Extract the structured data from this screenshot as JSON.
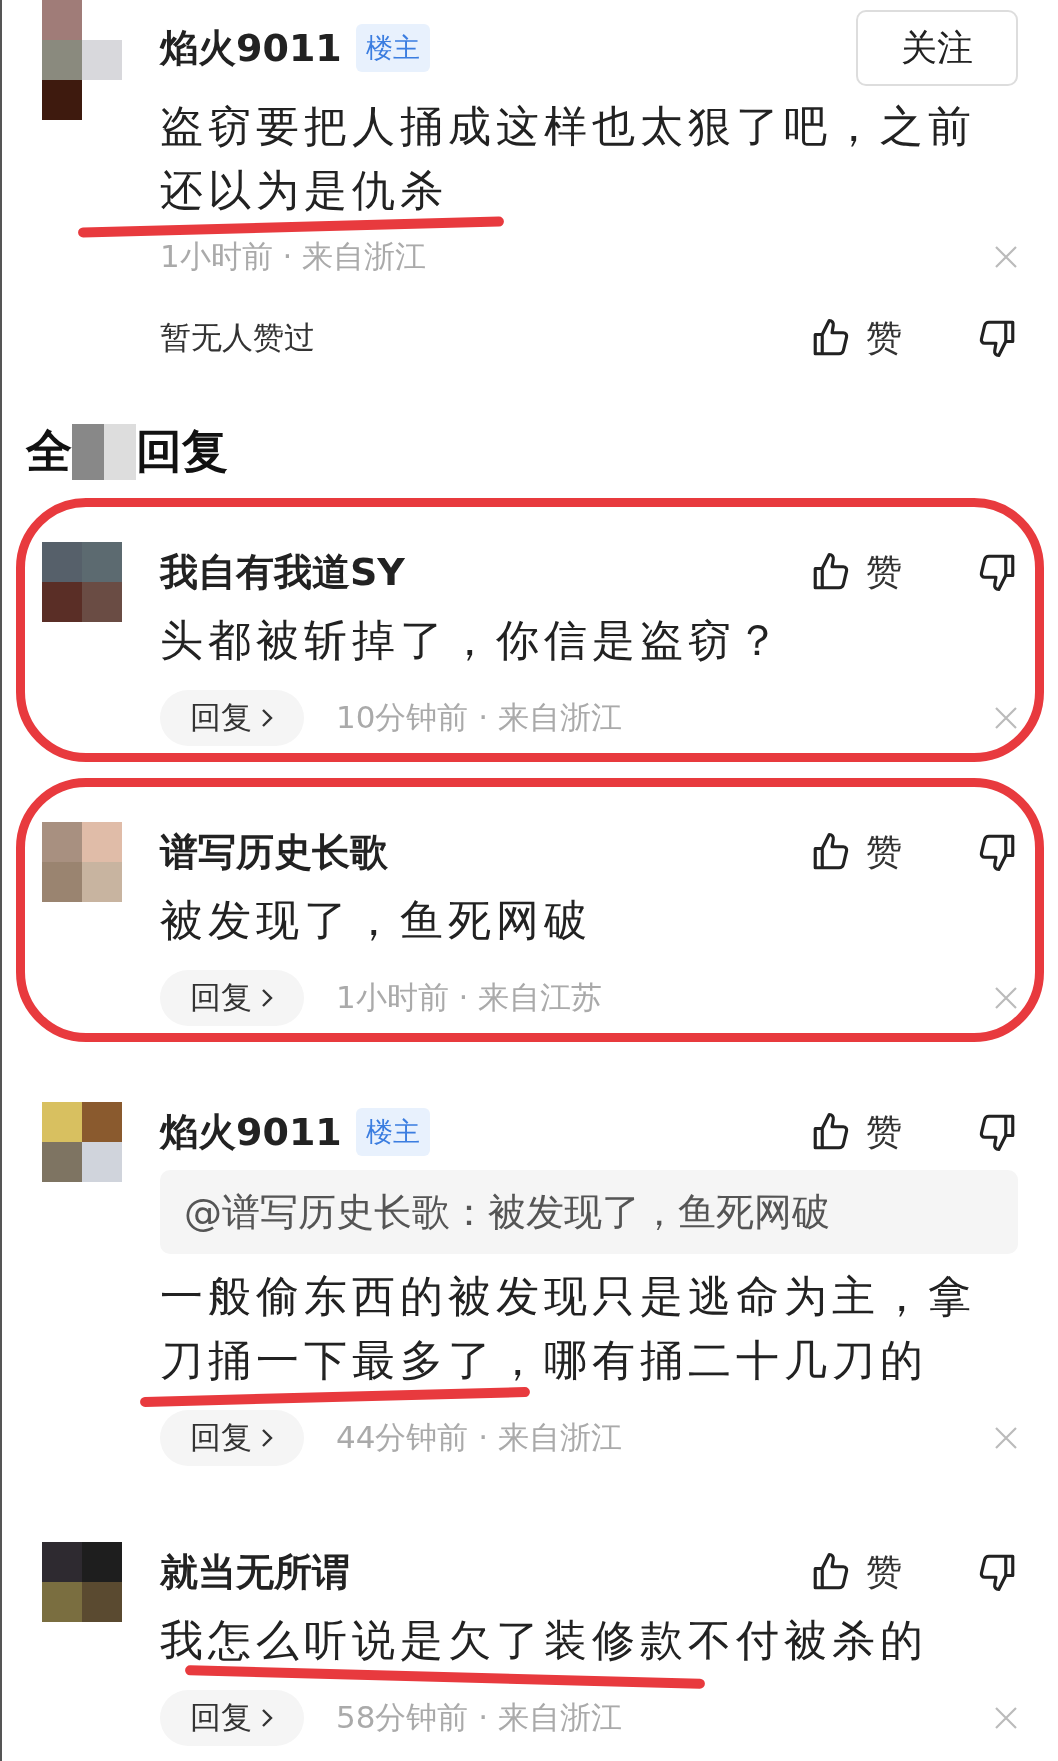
{
  "post": {
    "name": "焰火9011",
    "badge": "楼主",
    "follow": "关注",
    "body": "盗窃要把人捅成这样也太狠了吧，之前还以为是仇杀",
    "meta": "1小时前 · 来自浙江",
    "likes_summary": "暂无人赞过",
    "like_label": "赞",
    "underlined": true
  },
  "section_title": {
    "start": "全",
    "end": "回复"
  },
  "replies": [
    {
      "name": "我自有我道SY",
      "body": "头都被斩掉了，你信是盗窃？",
      "reply_label": "回复",
      "meta": "10分钟前 · 来自浙江",
      "like_label": "赞",
      "underlined": false,
      "circled": true
    },
    {
      "name": "谱写历史长歌",
      "body": "被发现了，鱼死网破",
      "reply_label": "回复",
      "meta": "1小时前 · 来自江苏",
      "like_label": "赞",
      "underlined": false,
      "circled": true
    },
    {
      "name": "焰火9011",
      "badge": "楼主",
      "quote": "@谱写历史长歌：被发现了，鱼死网破",
      "body": "一般偷东西的被发现只是逃命为主，拿刀捅一下最多了，哪有捅二十几刀的",
      "reply_label": "回复",
      "meta": "44分钟前 · 来自浙江",
      "like_label": "赞",
      "underlined": true,
      "circled": false
    },
    {
      "name": "就当无所谓",
      "body": "我怎么听说是欠了装修款不付被杀的",
      "reply_label": "回复",
      "meta": "58分钟前 · 来自浙江",
      "like_label": "赞",
      "underlined": true,
      "circled": false
    }
  ]
}
